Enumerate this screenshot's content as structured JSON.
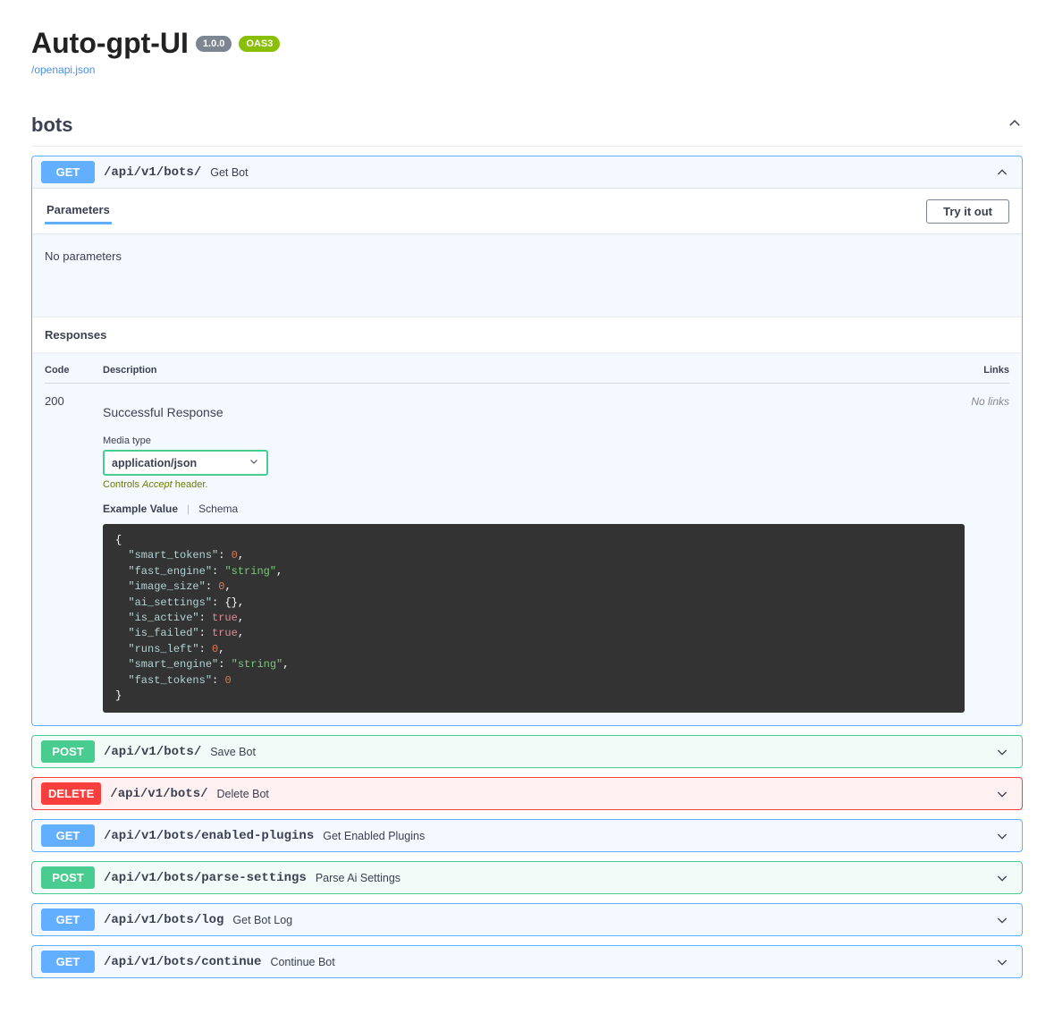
{
  "header": {
    "title": "Auto-gpt-UI",
    "version": "1.0.0",
    "oas": "OAS3",
    "spec_link": "/openapi.json"
  },
  "tag": {
    "name": "bots"
  },
  "expanded": {
    "method": "GET",
    "path": "/api/v1/bots/",
    "summary": "Get Bot",
    "parameters_tab": "Parameters",
    "try_label": "Try it out",
    "no_parameters": "No parameters",
    "responses_label": "Responses",
    "table": {
      "code": "Code",
      "description": "Description",
      "links": "Links"
    },
    "response": {
      "code": "200",
      "description": "Successful Response",
      "no_links": "No links",
      "media_label": "Media type",
      "media_value": "application/json",
      "accept_hint_pre": "Controls ",
      "accept_hint_hdr": "Accept",
      "accept_hint_post": " header.",
      "example_tab": "Example Value",
      "schema_tab": "Schema",
      "example": {
        "smart_tokens": 0,
        "fast_engine": "string",
        "image_size": 0,
        "ai_settings": {},
        "is_active": true,
        "is_failed": true,
        "runs_left": 0,
        "smart_engine": "string",
        "fast_tokens": 0
      }
    }
  },
  "ops": [
    {
      "method": "POST",
      "path": "/api/v1/bots/",
      "summary": "Save Bot"
    },
    {
      "method": "DELETE",
      "path": "/api/v1/bots/",
      "summary": "Delete Bot"
    },
    {
      "method": "GET",
      "path": "/api/v1/bots/enabled-plugins",
      "summary": "Get Enabled Plugins"
    },
    {
      "method": "POST",
      "path": "/api/v1/bots/parse-settings",
      "summary": "Parse Ai Settings"
    },
    {
      "method": "GET",
      "path": "/api/v1/bots/log",
      "summary": "Get Bot Log"
    },
    {
      "method": "GET",
      "path": "/api/v1/bots/continue",
      "summary": "Continue Bot"
    }
  ]
}
